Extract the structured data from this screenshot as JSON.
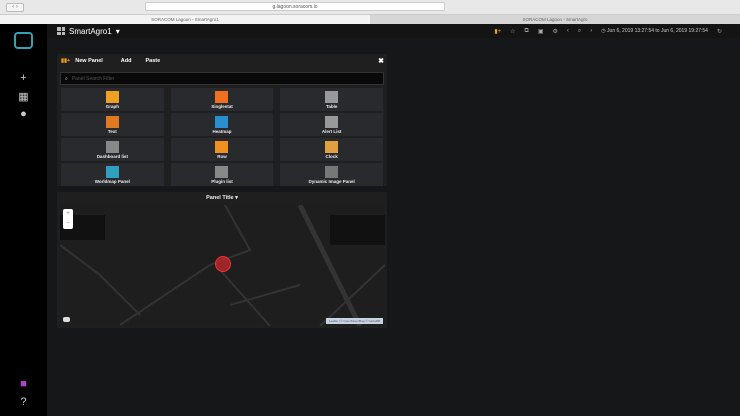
{
  "browser": {
    "url": "g.lagoon.soracom.io",
    "tabs": [
      "SORACOM Lagoon - SmartAgro1",
      "SORACOM Lagoon - SmartAgro"
    ]
  },
  "dashboard": {
    "title": "SmartAgro1",
    "time_range": "Jun 6, 2019 13:27:54 to Jun 6, 2019 19:27:54"
  },
  "new_panel": {
    "title": "New Panel",
    "tabs": [
      "Add",
      "Paste"
    ],
    "search_placeholder": "Panel Search Filter",
    "items": [
      {
        "label": "Graph",
        "icon": "graph-icon",
        "color": "#f0a020"
      },
      {
        "label": "Singlestat",
        "icon": "singlestat-icon",
        "color": "#f07020"
      },
      {
        "label": "Table",
        "icon": "table-icon",
        "color": "#999999"
      },
      {
        "label": "Text",
        "icon": "text-icon",
        "color": "#e07a20"
      },
      {
        "label": "Heatmap",
        "icon": "heatmap-icon",
        "color": "#2a8fd0"
      },
      {
        "label": "Alert List",
        "icon": "alert-list-icon",
        "color": "#999999"
      },
      {
        "label": "Dashboard list",
        "icon": "dashboard-list-icon",
        "color": "#888888"
      },
      {
        "label": "Row",
        "icon": "row-icon",
        "color": "#f09020"
      },
      {
        "label": "Clock",
        "icon": "clock-icon",
        "color": "#e0a040"
      },
      {
        "label": "Worldmap Panel",
        "icon": "worldmap-icon",
        "color": "#30a0c0"
      },
      {
        "label": "Plugin list",
        "icon": "plugin-list-icon",
        "color": "#888888"
      },
      {
        "label": "Dynamic Image Panel",
        "icon": "image-panel-icon",
        "color": "#777777"
      }
    ]
  },
  "panel": {
    "title": "Panel Title",
    "zoom_in": "+",
    "zoom_out": "−",
    "attribution": "Leaflet | © OpenStreetMap © CartoDB"
  }
}
